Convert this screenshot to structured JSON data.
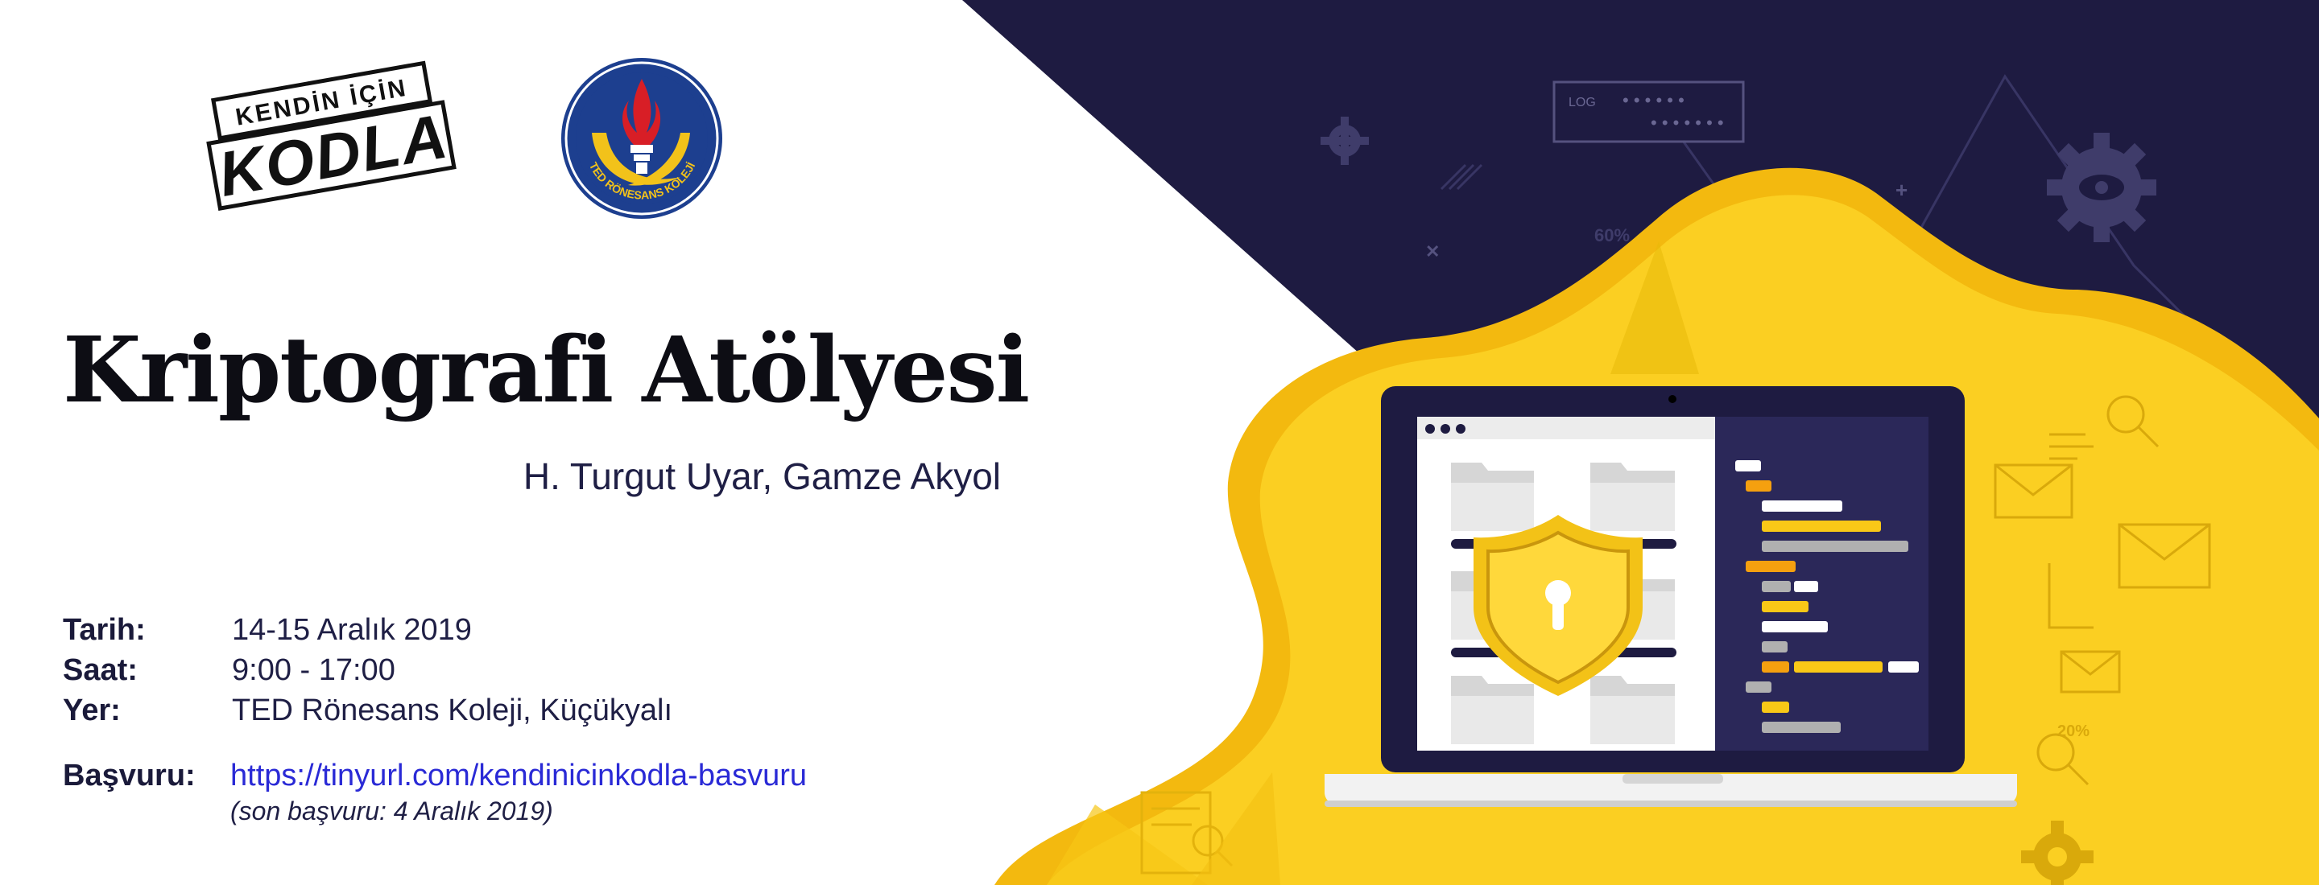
{
  "logos": {
    "kodla": {
      "line1": "KENDİN İÇİN",
      "line2": "KODLA"
    },
    "ted": {
      "ring_text": "TED RÖNESANS KOLEJİ"
    }
  },
  "title": "Kriptografi Atölyesi",
  "authors": "H. Turgut Uyar, Gamze Akyol",
  "info": {
    "date": {
      "label": "Tarih:",
      "value": "14-15 Aralık 2019"
    },
    "time": {
      "label": "Saat:",
      "value": "9:00 - 17:00"
    },
    "place": {
      "label": "Yer:",
      "value": "TED Rönesans Koleji, Küçükyalı"
    },
    "application": {
      "label": "Başvuru:",
      "link": "https://tinyurl.com/kendinicinkodla-basvuru",
      "note": "(son başvuru: 4 Aralık 2019)"
    }
  },
  "decor": {
    "log_label": "LOG",
    "percent_a": "60%",
    "percent_b": "20%"
  },
  "colors": {
    "navy": "#1e1b41",
    "yellow": "#f8cb1c",
    "link": "#2a2ad6"
  }
}
